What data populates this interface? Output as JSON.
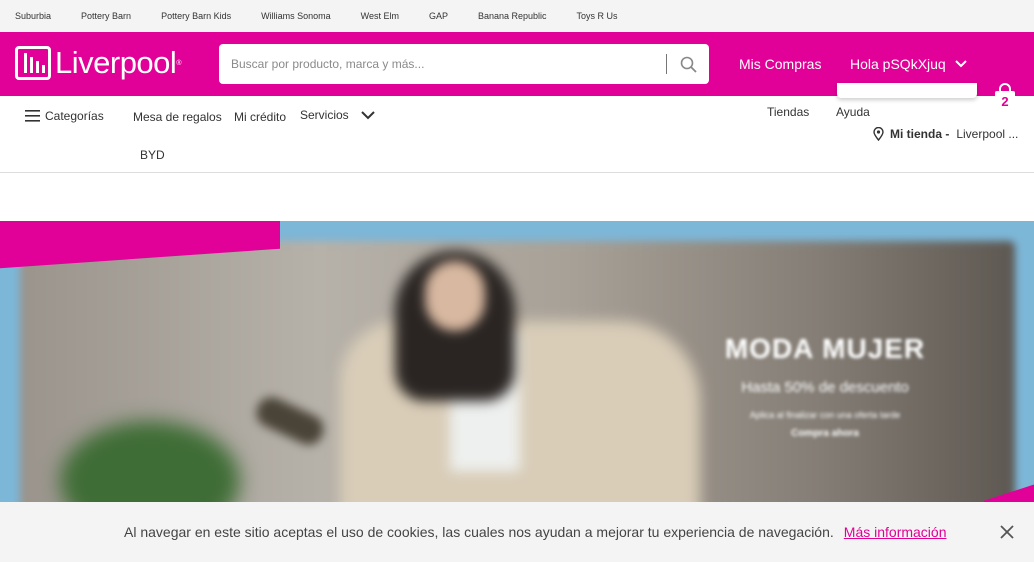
{
  "top_links": [
    "Suburbia",
    "Pottery Barn",
    "Pottery Barn Kids",
    "Williams Sonoma",
    "West Elm",
    "GAP",
    "Banana Republic",
    "Toys R Us"
  ],
  "brand": {
    "name": "Liverpool",
    "registered": "®",
    "color": "#e10098"
  },
  "search": {
    "placeholder": "Buscar por producto, marca y más...",
    "icon": "search-icon"
  },
  "header": {
    "mis_compras": "Mis Compras",
    "greeting": "Hola pSQkXjuq",
    "cart_count": "2"
  },
  "nav": {
    "categorias": "Categorías",
    "mesa_regalos": "Mesa de regalos",
    "mi_credito": "Mi crédito",
    "servicios": "Servicios",
    "byd": "BYD",
    "tiendas": "Tiendas",
    "ayuda": "Ayuda",
    "mi_tienda_label": "Mi tienda -",
    "mi_tienda_value": "Liverpool ..."
  },
  "hero": {
    "title": "MODA MUJER",
    "subtitle": "Hasta 50% de descuento",
    "fine_print": "Aplica al finalizar con una oferta tarde",
    "cta": "Compra ahora"
  },
  "cookie": {
    "text": "Al navegar en este sitio aceptas el uso de cookies, las cuales nos ayudan a mejorar tu experiencia de navegación.",
    "link": "Más información"
  }
}
